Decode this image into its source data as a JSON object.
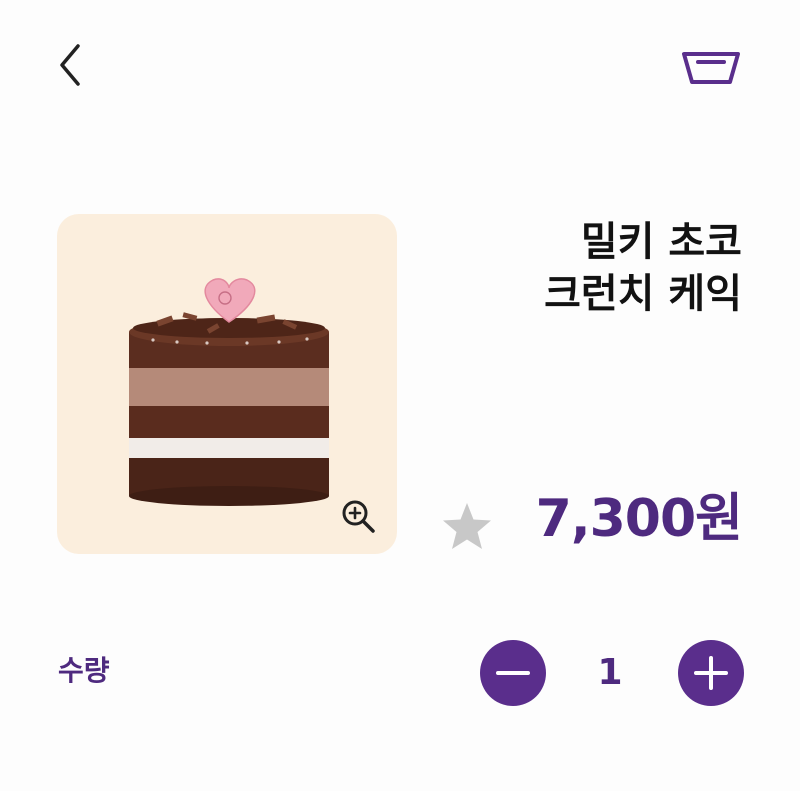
{
  "product": {
    "name_line1": "밀키 초코",
    "name_line2": "크런치 케익",
    "price": "7,300원",
    "image_background": "#fbeedd"
  },
  "quantity": {
    "label": "수량",
    "value": "1"
  },
  "icons": {
    "back": "chevron-left-icon",
    "cart": "basket-icon",
    "zoom": "zoom-in-icon",
    "favorite": "star-icon",
    "decrease": "minus-icon",
    "increase": "plus-icon"
  },
  "colors": {
    "accent": "#4e2a7f",
    "button": "#5a2e8c",
    "star": "#c8c8c8"
  }
}
